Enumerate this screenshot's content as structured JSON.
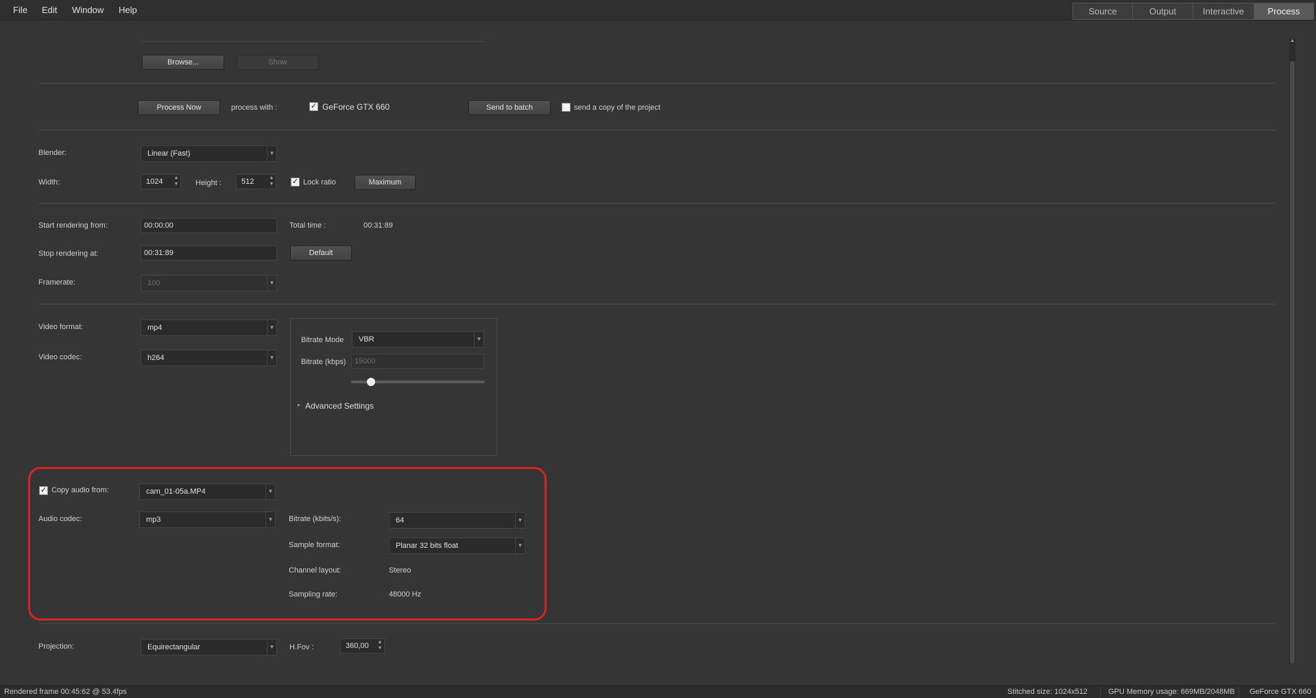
{
  "menu": {
    "file": "File",
    "edit": "Edit",
    "window": "Window",
    "help": "Help"
  },
  "tabs": {
    "source": "Source",
    "output": "Output",
    "interactive": "Interactive",
    "process": "Process",
    "active": "Process"
  },
  "output_path": {
    "browse_label": "Browse...",
    "show_label": "Show"
  },
  "process_row": {
    "process_now_label": "Process Now",
    "process_with_label": "process with :",
    "gpu_checked": true,
    "gpu_label": "GeForce GTX 660",
    "send_to_batch_label": "Send to batch",
    "send_copy_checked": false,
    "send_copy_label": "send a copy of the project"
  },
  "blender": {
    "label": "Blender:",
    "value": "Linear (Fast)"
  },
  "size": {
    "width_label": "Width:",
    "width_value": "1024",
    "height_label": "Height :",
    "height_value": "512",
    "lock_ratio_checked": true,
    "lock_ratio_label": "Lock ratio",
    "maximum_label": "Maximum"
  },
  "timing": {
    "start_label": "Start rendering from:",
    "start_value": "00:00:00",
    "total_time_label": "Total time :",
    "total_time_value": "00:31:89",
    "stop_label": "Stop rendering at:",
    "stop_value": "00:31:89",
    "default_label": "Default",
    "framerate_label": "Framerate:",
    "framerate_value": "100"
  },
  "video": {
    "format_label": "Video format:",
    "format_value": "mp4",
    "codec_label": "Video codec:",
    "codec_value": "h264",
    "bitrate_mode_label": "Bitrate Mode",
    "bitrate_mode_value": "VBR",
    "bitrate_label": "Bitrate (kbps)",
    "bitrate_value": "15000",
    "bitrate_slider_fraction": 0.15,
    "advanced_label": "Advanced Settings"
  },
  "audio": {
    "copy_checked": true,
    "copy_label": "Copy audio from:",
    "copy_source": "cam_01-05a.MP4",
    "codec_label": "Audio codec:",
    "codec_value": "mp3",
    "bitrate_label": "Bitrate (kbits/s):",
    "bitrate_value": "64",
    "sample_format_label": "Sample format:",
    "sample_format_value": "Planar 32 bits float",
    "channel_layout_label": "Channel layout:",
    "channel_layout_value": "Stereo",
    "sampling_rate_label": "Sampling rate:",
    "sampling_rate_value": "48000 Hz"
  },
  "projection": {
    "label": "Projection:",
    "value": "Equirectangular",
    "hfov_label": "H.Fov :",
    "hfov_value": "360,00"
  },
  "status": {
    "rendered": "Rendered frame 00:45:62 @ 53.4fps",
    "stitched": "Stitched size: 1024x512",
    "gpu_memory": "GPU Memory usage: 669MB/2048MB",
    "gpu_name": "GeForce GTX 660"
  },
  "colors": {
    "highlight": "#d8232a",
    "background": "#353535"
  }
}
